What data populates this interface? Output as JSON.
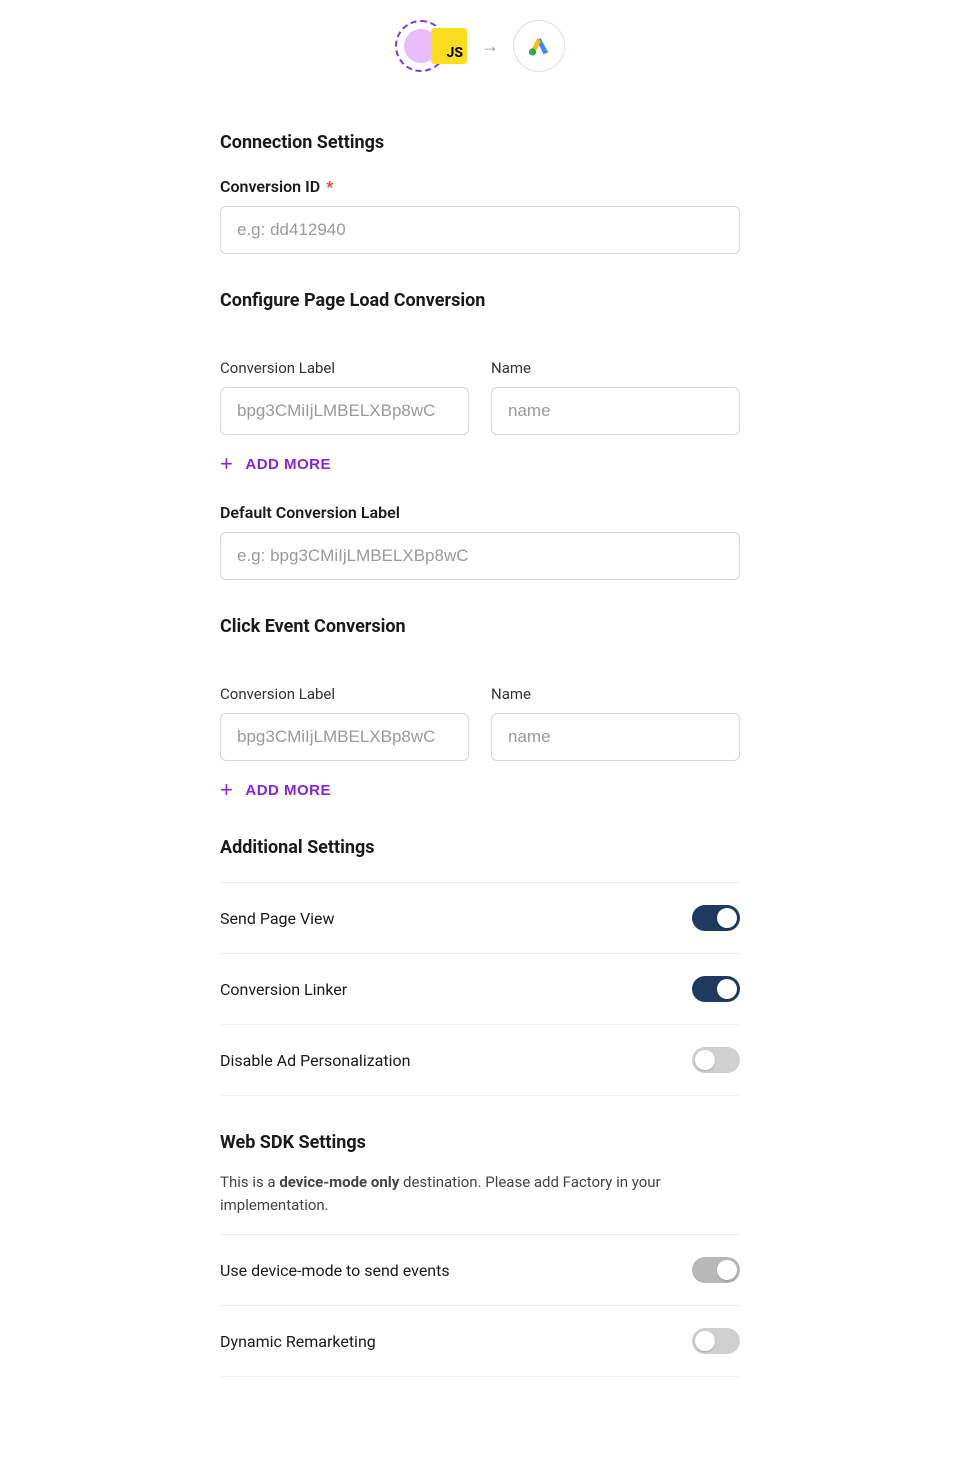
{
  "flow": {
    "js_label": "JS"
  },
  "connection": {
    "heading": "Connection Settings",
    "conversion_id_label": "Conversion ID",
    "conversion_id_placeholder": "e.g: dd412940"
  },
  "page_load": {
    "heading": "Configure Page Load Conversion",
    "conversion_label": "Conversion Label",
    "conversion_placeholder": "bpg3CMiIjLMBELXBp8wC",
    "name_label": "Name",
    "name_placeholder": "name",
    "add_more": "ADD MORE",
    "default_label": "Default Conversion Label",
    "default_placeholder": "e.g: bpg3CMiIjLMBELXBp8wC"
  },
  "click_event": {
    "heading": "Click Event Conversion",
    "conversion_label": "Conversion Label",
    "conversion_placeholder": "bpg3CMiIjLMBELXBp8wC",
    "name_label": "Name",
    "name_placeholder": "name",
    "add_more": "ADD MORE"
  },
  "additional": {
    "heading": "Additional Settings",
    "rows": [
      {
        "label": "Send Page View",
        "state": "on"
      },
      {
        "label": "Conversion Linker",
        "state": "on"
      },
      {
        "label": "Disable Ad Personalization",
        "state": "off"
      }
    ]
  },
  "sdk": {
    "heading": "Web SDK Settings",
    "note_prefix": "This is a ",
    "note_bold": "device-mode only",
    "note_suffix": " destination. Please add Factory in your implementation.",
    "rows": [
      {
        "label": "Use device-mode to send events",
        "state": "on-grey"
      },
      {
        "label": "Dynamic Remarketing",
        "state": "off"
      }
    ]
  }
}
